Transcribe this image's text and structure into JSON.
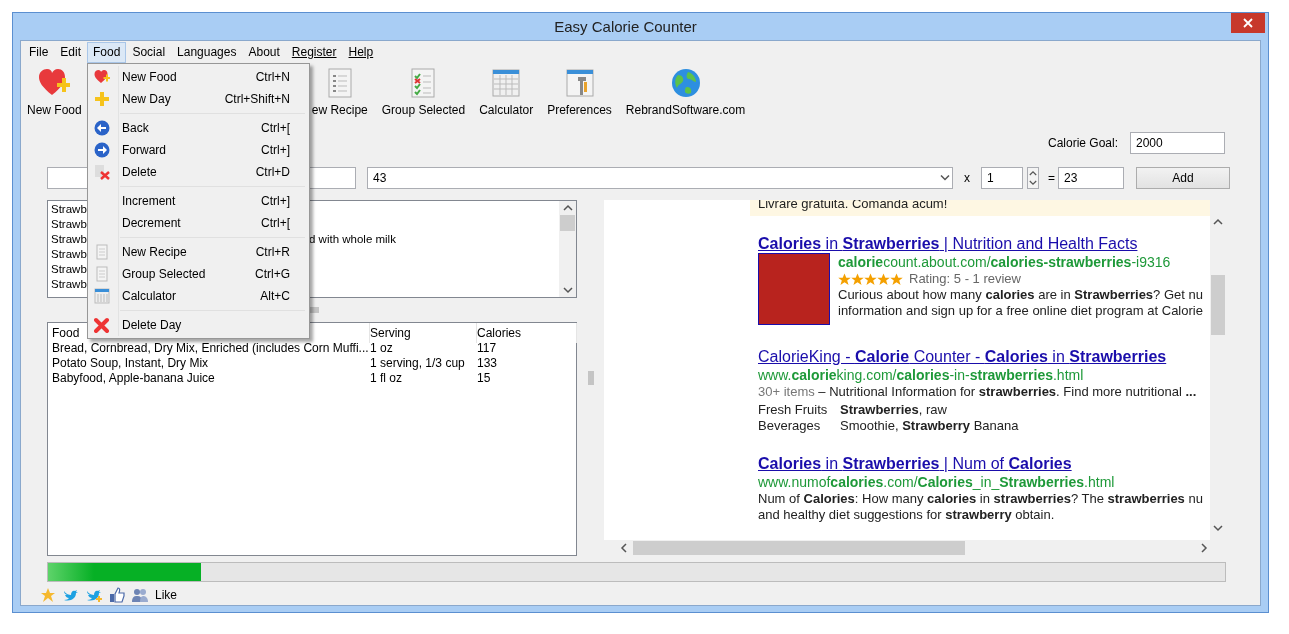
{
  "window": {
    "title": "Easy Calorie Counter"
  },
  "menu_bar": [
    {
      "label": "File",
      "selected": false,
      "underlined": false
    },
    {
      "label": "Edit",
      "selected": false,
      "underlined": false
    },
    {
      "label": "Food",
      "selected": true,
      "underlined": false
    },
    {
      "label": "Social",
      "selected": false,
      "underlined": false
    },
    {
      "label": "Languages",
      "selected": false,
      "underlined": false
    },
    {
      "label": "About",
      "selected": false,
      "underlined": false
    },
    {
      "label": "Register",
      "selected": false,
      "underlined": true
    },
    {
      "label": "Help",
      "selected": false,
      "underlined": true
    }
  ],
  "toolbar": [
    {
      "label": "New Food"
    },
    {
      "label": "ew Recipe"
    },
    {
      "label": "Group Selected"
    },
    {
      "label": "Calculator"
    },
    {
      "label": "Preferences"
    },
    {
      "label": "RebrandSoftware.com"
    }
  ],
  "calorie_goal": {
    "label": "Calorie Goal:",
    "value": "2000"
  },
  "entry": {
    "food_value": "43",
    "times": "x",
    "quantity": "1",
    "equals": "=",
    "result": "23",
    "add_button": "Add"
  },
  "food_list": {
    "rows": [
      {
        "text": "Strawb"
      },
      {
        "text": "Strawb"
      },
      {
        "text": "Strawb",
        "tail": "d with whole milk"
      },
      {
        "text": "Strawb"
      },
      {
        "text": "Strawb"
      },
      {
        "text": "Strawb"
      }
    ]
  },
  "log_table": {
    "columns": [
      "Food",
      "Serving",
      "Calories"
    ],
    "rows": [
      [
        "Bread, Cornbread, Dry Mix, Enriched (includes Corn Muffi...",
        "1 oz",
        "117"
      ],
      [
        "Potato Soup, Instant, Dry Mix",
        "1 serving, 1/3 cup",
        "133"
      ],
      [
        "Babyfood, Apple-banana Juice",
        "1 fl oz",
        "15"
      ]
    ]
  },
  "browser": {
    "ad_text": "Livrare gratuita. Comanda acum!",
    "results": [
      {
        "kind": "rated",
        "title": "**Calories** in **Strawberries** | Nutrition and Health Facts",
        "url": "**calorie**count.about.com/**calories-strawberries**-i9316",
        "stars": 5,
        "rating": "Rating: 5 - 1 review",
        "snippet": [
          "Curious about how many **calories** are in **Strawberries**? Get nu",
          "information and sign up for a free online diet program at Calorie"
        ]
      },
      {
        "kind": "table",
        "title": "CalorieKing - **Calorie** Counter - **Calories** in **Strawberries**",
        "url": "www.**calorie**king.com/**calories**-in-**strawberries**.html",
        "meta": "30+ items",
        "summary": "– Nutritional Information for **strawberries**. Find more nutritional **...**",
        "rows": [
          {
            "label": "Fresh Fruits",
            "value": "**Strawberries**, raw"
          },
          {
            "label": "Beverages",
            "value": "Smoothie, **Strawberry** Banana"
          }
        ]
      },
      {
        "kind": "plain",
        "title": "**Calories** in **Strawberries** | Num of **Calories**",
        "url": "www.numof**calories**.com/**Calories**_in_**Strawberries**.html",
        "snippet": [
          "Num of **Calories**: How many **calories** in **strawberries**? The **strawberries** nu",
          "and healthy diet suggestions for **strawberry** obtain."
        ]
      }
    ]
  },
  "progress": {
    "level": 0.13
  },
  "status_bar": {
    "like": "Like"
  },
  "food_menu": {
    "sections": [
      [
        {
          "label": "New Food",
          "shortcut": "Ctrl+N"
        },
        {
          "label": "New Day",
          "shortcut": "Ctrl+Shift+N"
        }
      ],
      [
        {
          "label": "Back",
          "shortcut": "Ctrl+["
        },
        {
          "label": "Forward",
          "shortcut": "Ctrl+]"
        },
        {
          "label": "Delete",
          "shortcut": "Ctrl+D"
        }
      ],
      [
        {
          "label": "Increment",
          "shortcut": "Ctrl+]"
        },
        {
          "label": "Decrement",
          "shortcut": "Ctrl+["
        }
      ],
      [
        {
          "label": "New Recipe",
          "shortcut": "Ctrl+R"
        },
        {
          "label": "Group Selected",
          "shortcut": "Ctrl+G"
        },
        {
          "label": "Calculator",
          "shortcut": "Alt+C"
        }
      ],
      [
        {
          "label": "Delete Day"
        }
      ]
    ]
  }
}
